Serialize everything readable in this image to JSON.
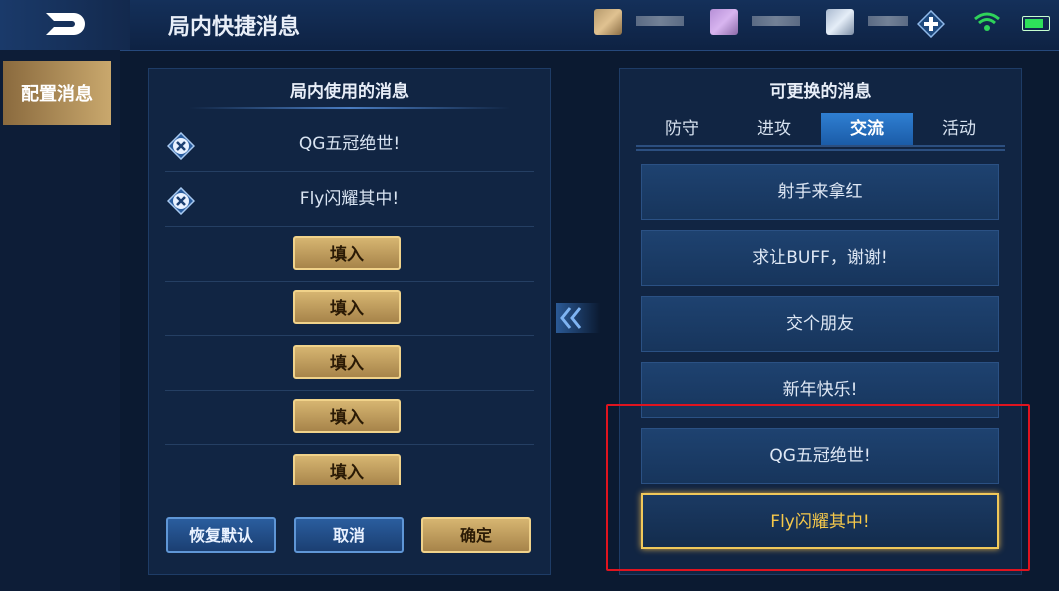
{
  "header": {
    "title": "局内快捷消息"
  },
  "sidebar": {
    "items": [
      {
        "label": "配置消息"
      }
    ]
  },
  "left_panel": {
    "title": "局内使用的消息",
    "used_messages": [
      "QG五冠绝世!",
      "Fly闪耀其中!"
    ],
    "fill_label": "填入",
    "empty_slots": 5
  },
  "buttons": {
    "restore": "恢复默认",
    "cancel": "取消",
    "confirm": "确定"
  },
  "right_panel": {
    "title": "可更换的消息",
    "tabs": [
      "防守",
      "进攻",
      "交流",
      "活动"
    ],
    "active_tab": "交流",
    "options": [
      "射手来拿红",
      "求让BUFF，谢谢!",
      "交个朋友",
      "新年快乐!",
      "QG五冠绝世!",
      "Fly闪耀其中!"
    ],
    "selected_option": "Fly闪耀其中!"
  },
  "colors": {
    "accent_gold": "#f0c85a",
    "highlight_red": "#e0141f",
    "active_tab": "#2f7fd2"
  },
  "icons": [
    "back-arrow-icon",
    "plus-icon",
    "wifi-icon",
    "battery-icon",
    "remove-icon",
    "double-chevron-left-icon"
  ]
}
